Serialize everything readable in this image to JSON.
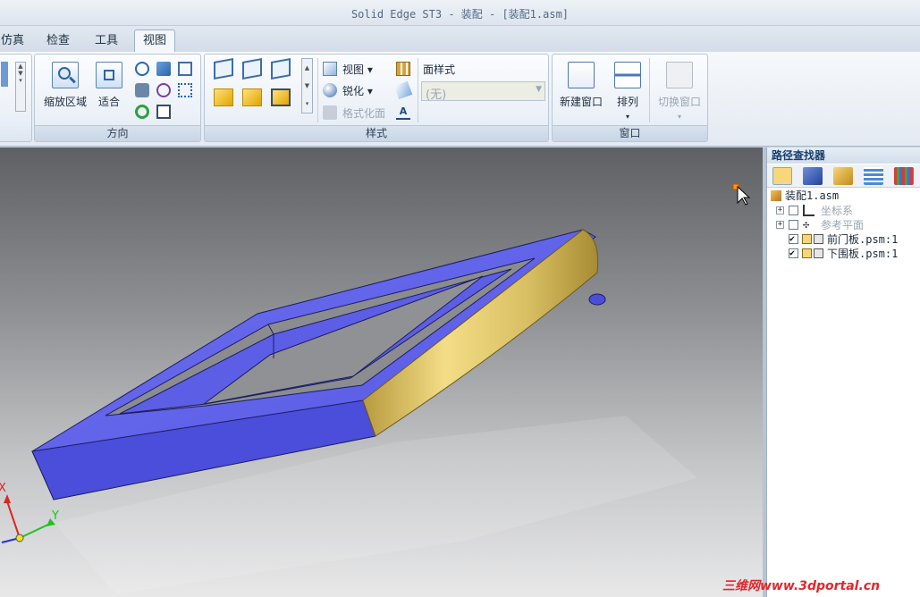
{
  "window": {
    "title": "Solid Edge ST3 - 装配 - [装配1.asm]"
  },
  "tabs": [
    {
      "label": "仿真",
      "active": false
    },
    {
      "label": "检查",
      "active": false
    },
    {
      "label": "工具",
      "active": false
    },
    {
      "label": "视图",
      "active": true
    }
  ],
  "ribbon": {
    "direction": {
      "label": "方向",
      "zoom_area": "缩放区域",
      "fit": "适合"
    },
    "style": {
      "label": "样式",
      "view": "视图",
      "sharpen": "锐化",
      "format_face": "格式化面",
      "face_style_label": "面样式",
      "face_style_value": "(无)"
    },
    "window": {
      "label": "窗口",
      "new_window": "新建窗口",
      "arrange": "排列",
      "switch_window": "切换窗口"
    }
  },
  "pathfinder": {
    "title": "路径查找器",
    "root": "装配1.asm",
    "items": [
      {
        "label": "坐标系",
        "checked": false,
        "expandable": true,
        "dim": true
      },
      {
        "label": "参考平面",
        "checked": false,
        "expandable": true,
        "dim": true
      },
      {
        "label": "前门板.psm:1",
        "checked": true,
        "expandable": false,
        "dim": false
      },
      {
        "label": "下围板.psm:1",
        "checked": true,
        "expandable": false,
        "dim": false
      }
    ]
  },
  "triad": {
    "x": "X",
    "y": "Y"
  },
  "watermark": "三维网www.3dportal.cn",
  "colors": {
    "part_blue": "#5a5ce8",
    "part_gold": "#d8c267",
    "ribbon_bg": "#e4eaf2",
    "accent": "#163d6b"
  }
}
